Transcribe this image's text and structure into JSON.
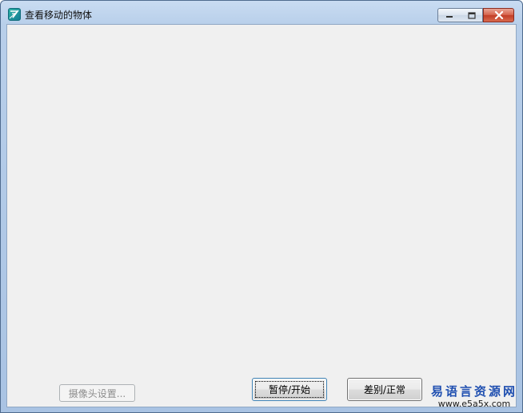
{
  "window": {
    "title": "查看移动的物体",
    "icon": "e-language-app-icon"
  },
  "caption_buttons": {
    "minimize_icon": "minimize-icon",
    "maximize_icon": "restore-icon",
    "close_icon": "close-icon"
  },
  "buttons": {
    "camera_settings": "摄像头设置...",
    "pause_start": "暂停/开始",
    "difference_normal": "差别/正常"
  },
  "watermark": {
    "name": "易语言资源网",
    "url": "www.e5a5x.com"
  },
  "colors": {
    "client_background": "#f0f0f0",
    "frame": "#b8cfea",
    "close_button": "#c23e27",
    "watermark": "#1f4fb0"
  }
}
